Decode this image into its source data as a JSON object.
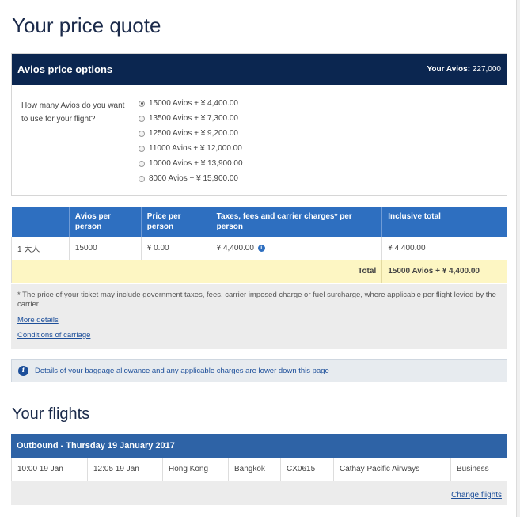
{
  "page": {
    "title": "Your price quote"
  },
  "avios": {
    "header_title": "Avios price options",
    "balance_label": "Your Avios:",
    "balance_value": "227,000",
    "question": "How many Avios do you want to use for your flight?",
    "options": [
      {
        "label": "15000 Avios + ¥ 4,400.00",
        "selected": true
      },
      {
        "label": "13500 Avios + ¥ 7,300.00",
        "selected": false
      },
      {
        "label": "12500 Avios + ¥ 9,200.00",
        "selected": false
      },
      {
        "label": "11000 Avios + ¥ 12,000.00",
        "selected": false
      },
      {
        "label": "10000 Avios + ¥ 13,900.00",
        "selected": false
      },
      {
        "label": "8000 Avios + ¥ 15,900.00",
        "selected": false
      }
    ]
  },
  "price_table": {
    "headers": [
      "",
      "Avios per person",
      "Price per person",
      "Taxes, fees and carrier charges* per person",
      "Inclusive total"
    ],
    "row": [
      "1 大人",
      "15000",
      "¥ 0.00",
      "¥ 4,400.00",
      "¥ 4,400.00"
    ],
    "total_label": "Total",
    "total_value": "15000 Avios + ¥ 4,400.00"
  },
  "notes": {
    "text": "* The price of your ticket may include government taxes, fees, carrier imposed charge or fuel surcharge, where applicable per flight levied by the carrier.",
    "more_details": "More details",
    "conditions": "Conditions of carriage"
  },
  "baggage": {
    "text": "Details of your baggage allowance and any applicable charges are lower down this page"
  },
  "flights": {
    "title": "Your flights",
    "outbound_header": "Outbound - Thursday 19 January 2017",
    "row": {
      "depart": "10:00 19 Jan",
      "arrive": "12:05 19 Jan",
      "from": "Hong Kong",
      "to": "Bangkok",
      "flight_no": "CX0615",
      "airline": "Cathay Pacific Airways",
      "cabin": "Business"
    },
    "change_link": "Change flights"
  },
  "colors": {
    "navy_header": "#0b2650",
    "blue_table": "#2e6fc0",
    "total_red": "#b31a1a",
    "total_bg": "#fdf6c3"
  }
}
